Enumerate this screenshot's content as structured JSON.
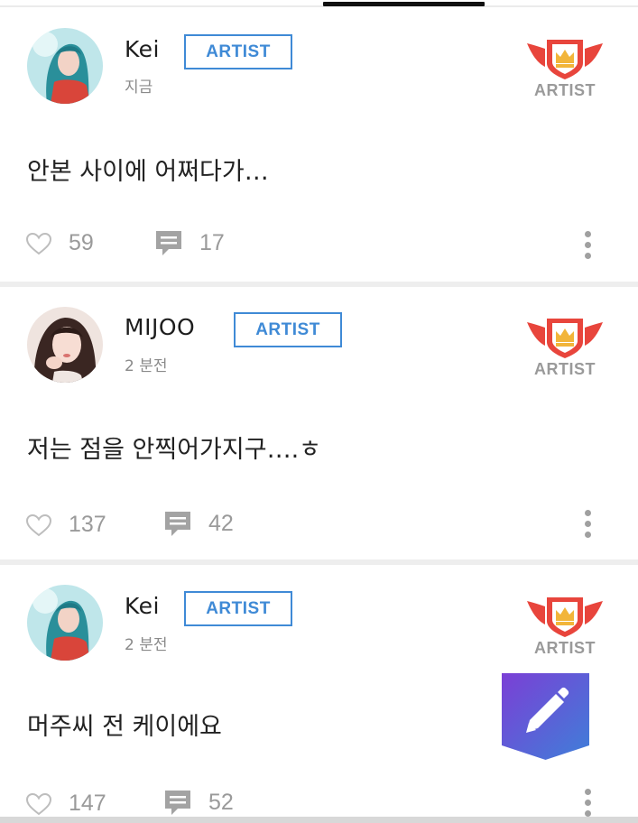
{
  "posts": [
    {
      "username": "Kei",
      "role_badge": "ARTIST",
      "timestamp": "지금",
      "emblem_label": "ARTIST",
      "text": "안본 사이에 어쩌다가…",
      "likes": "59",
      "comments": "17",
      "avatar": "kei-avatar"
    },
    {
      "username": "MIJOO",
      "role_badge": "ARTIST",
      "timestamp": "2 분전",
      "emblem_label": "ARTIST",
      "text": "저는 점을 안찍어가지구….ㅎ",
      "likes": "137",
      "comments": "42",
      "avatar": "mijoo-avatar"
    },
    {
      "username": "Kei",
      "role_badge": "ARTIST",
      "timestamp": "2 분전",
      "emblem_label": "ARTIST",
      "text": "머주씨 전 케이에요",
      "likes": "147",
      "comments": "52",
      "avatar": "kei-avatar"
    }
  ],
  "icons": {
    "like": "heart-outline-icon",
    "comment": "speech-bubble-icon",
    "more": "vertical-ellipsis-icon",
    "emblem": "winged-crown-shield-icon",
    "compose": "pencil-icon"
  },
  "colors": {
    "badge_blue": "#3f8ad6",
    "emblem_red": "#e8453c",
    "fab_gradient_start": "#7b3fd6",
    "fab_gradient_end": "#3f7fd8",
    "muted_text": "#9a9a9a"
  }
}
